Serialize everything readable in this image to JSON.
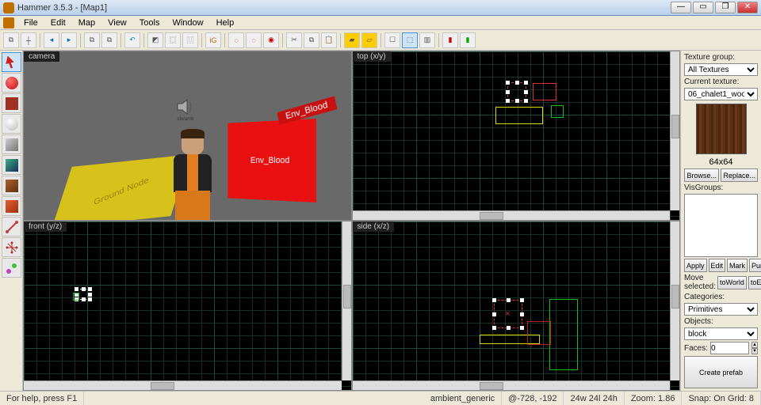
{
  "window": {
    "title": "Hammer 3.5.3 - [Map1]"
  },
  "menu": [
    "File",
    "Edit",
    "Map",
    "View",
    "Tools",
    "Window",
    "Help"
  ],
  "lefttools": [
    {
      "name": "selection-tool",
      "color": "#d02020",
      "sel": true,
      "shape": "arrow"
    },
    {
      "name": "magnify-tool",
      "color": "#d02020",
      "shape": "pin"
    },
    {
      "name": "camera-tool",
      "color": "#a03020",
      "shape": "box"
    },
    {
      "name": "entity-tool",
      "color": "#e0e0e0",
      "shape": "bulb"
    },
    {
      "name": "block-tool",
      "color": "#888",
      "shape": "cube"
    },
    {
      "name": "texture-tool",
      "color": "#208040",
      "shape": "cube"
    },
    {
      "name": "apply-tool",
      "color": "#904020",
      "shape": "cube"
    },
    {
      "name": "decal-tool",
      "color": "#c04020",
      "shape": "sphere"
    },
    {
      "name": "clip-tool",
      "color": "#c84040",
      "shape": "clip"
    },
    {
      "name": "vertex-tool",
      "color": "#d040c0",
      "shape": "vertex"
    },
    {
      "name": "path-tool",
      "color": "#c040c0",
      "shape": "path"
    }
  ],
  "viewports": {
    "camera": {
      "label": "camera",
      "yellow_text": "Ground\nNode",
      "red_text": "Env_Blood",
      "red_top": "Env_Blood",
      "speaker_label": "sfx/amb"
    },
    "top": {
      "label": "top (x/y)"
    },
    "front": {
      "label": "front (y/z)"
    },
    "side": {
      "label": "side (x/z)"
    }
  },
  "right": {
    "texgroup_label": "Texture group:",
    "texgroup_value": "All Textures",
    "curtex_label": "Current texture:",
    "curtex_value": "06_chalet1_woo",
    "tex_dims": "64x64",
    "browse": "Browse...",
    "replace": "Replace...",
    "visgroups_label": "VisGroups:",
    "apply": "Apply",
    "edit": "Edit",
    "mark": "Mark",
    "purge": "Purge",
    "move_label": "Move\nselected:",
    "toWorld": "toWorld",
    "toEntity": "toEntity",
    "categories_label": "Categories:",
    "categories_value": "Primitives",
    "objects_label": "Objects:",
    "objects_value": "block",
    "faces_label": "Faces:",
    "faces_value": "0",
    "create_prefab": "Create prefab"
  },
  "status": {
    "help": "For help, press F1",
    "entity": "ambient_generic",
    "coords": "@-728, -192",
    "dims": "24w 24l 24h",
    "zoom": "Zoom: 1.86",
    "snap": "Snap: On Grid: 8"
  }
}
